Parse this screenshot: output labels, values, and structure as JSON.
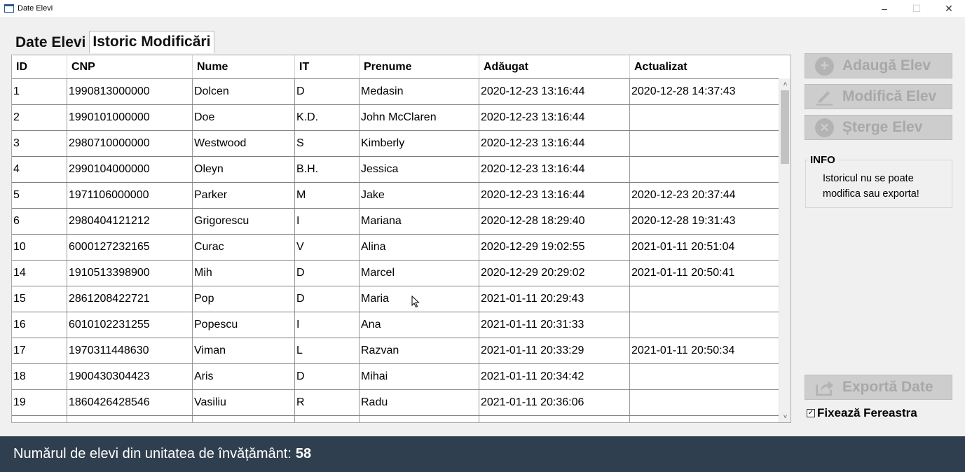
{
  "window": {
    "title": "Date Elevi",
    "minimize": "–",
    "maximize": "☐",
    "close": "✕"
  },
  "tabs": [
    {
      "label": "Date Elevi",
      "active": false
    },
    {
      "label": "Istoric Modificări",
      "active": true
    }
  ],
  "table": {
    "columns": [
      "ID",
      "CNP",
      "Nume",
      "IT",
      "Prenume",
      "Adăugat",
      "Actualizat"
    ],
    "rows": [
      [
        "1",
        "1990813000000",
        "Dolcen",
        "D",
        "Medasin",
        "2020-12-23 13:16:44",
        "2020-12-28 14:37:43"
      ],
      [
        "2",
        "1990101000000",
        "Doe",
        "K.D.",
        "John McClaren",
        "2020-12-23 13:16:44",
        ""
      ],
      [
        "3",
        "2980710000000",
        "Westwood",
        "S",
        "Kimberly",
        "2020-12-23 13:16:44",
        ""
      ],
      [
        "4",
        "2990104000000",
        "Oleyn",
        "B.H.",
        "Jessica",
        "2020-12-23 13:16:44",
        ""
      ],
      [
        "5",
        "1971106000000",
        "Parker",
        "M",
        "Jake",
        "2020-12-23 13:16:44",
        "2020-12-23 20:37:44"
      ],
      [
        "6",
        "2980404121212",
        "Grigorescu",
        "I",
        "Mariana",
        "2020-12-28 18:29:40",
        "2020-12-28 19:31:43"
      ],
      [
        "10",
        "6000127232165",
        "Curac",
        "V",
        "Alina",
        "2020-12-29 19:02:55",
        "2021-01-11 20:51:04"
      ],
      [
        "14",
        "1910513398900",
        "Mih",
        "D",
        "Marcel",
        "2020-12-29 20:29:02",
        "2021-01-11 20:50:41"
      ],
      [
        "15",
        "2861208422721",
        "Pop",
        "D",
        "Maria",
        "2021-01-11 20:29:43",
        ""
      ],
      [
        "16",
        "6010102231255",
        "Popescu",
        "I",
        "Ana",
        "2021-01-11 20:31:33",
        ""
      ],
      [
        "17",
        "1970311448630",
        "Viman",
        "L",
        "Razvan",
        "2021-01-11 20:33:29",
        "2021-01-11 20:50:34"
      ],
      [
        "18",
        "1900430304423",
        "Aris",
        "D",
        "Mihai",
        "2021-01-11 20:34:42",
        ""
      ],
      [
        "19",
        "1860426428546",
        "Vasiliu",
        "R",
        "Radu",
        "2021-01-11 20:36:06",
        ""
      ],
      [
        "",
        "",
        "",
        "",
        "",
        "",
        ""
      ]
    ]
  },
  "actions": {
    "add": {
      "label": "Adaugă Elev",
      "icon": "plus-circle-icon",
      "enabled": false
    },
    "edit": {
      "label": "Modifică Elev",
      "icon": "pencil-icon",
      "enabled": false
    },
    "delete": {
      "label": "Șterge Elev",
      "icon": "x-circle-icon",
      "enabled": false
    },
    "export": {
      "label": "Exportă Date",
      "icon": "share-icon",
      "enabled": false
    }
  },
  "info": {
    "title": "INFO",
    "text": "Istoricul nu se poate modifica sau exporta!"
  },
  "pin_window": {
    "label": "Fixează Fereastra",
    "checked": true,
    "check_glyph": "✓"
  },
  "status": {
    "label": "Numărul de elevi din unitatea de învățământ:",
    "count": "58"
  },
  "scrollbar": {
    "up": "˄",
    "down": "˅"
  },
  "colors": {
    "status_bg": "#2f3f4f",
    "disabled_button_bg": "#cdcdcd",
    "disabled_text": "#a8a8a8"
  }
}
